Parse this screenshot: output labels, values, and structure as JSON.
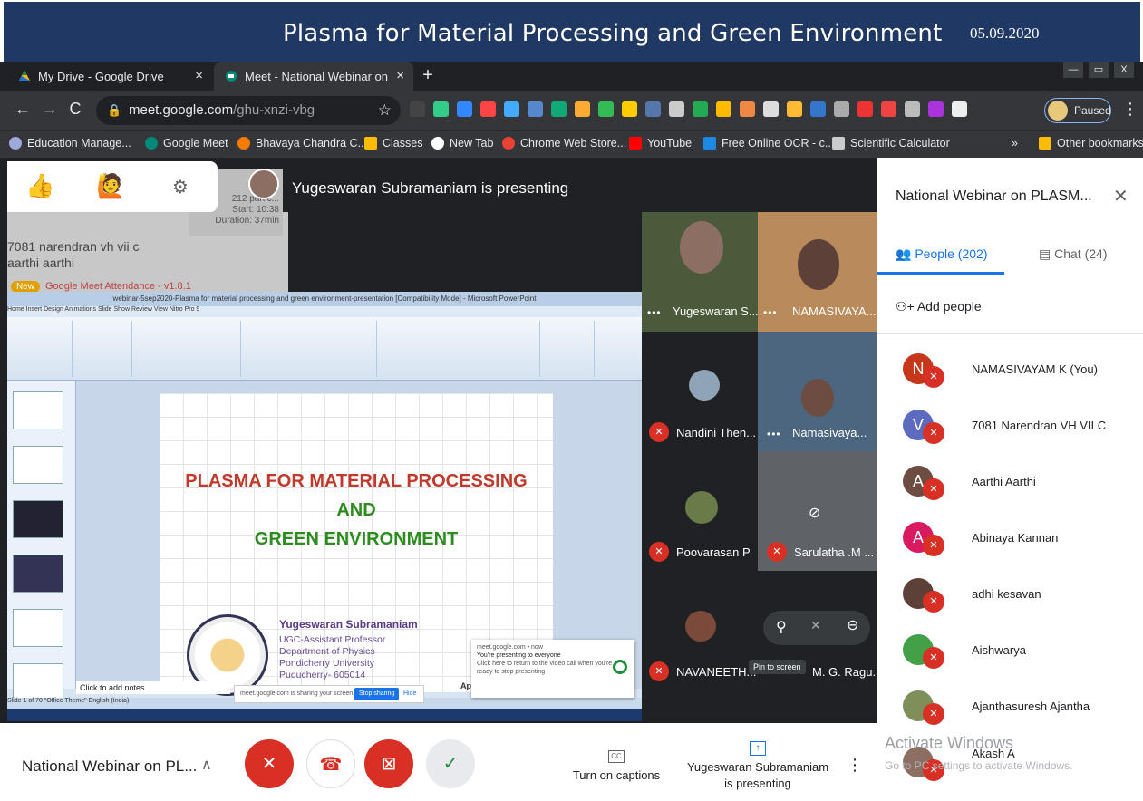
{
  "banner": {
    "title": "Plasma for Material Processing and Green Environment",
    "date": "05.09.2020"
  },
  "browser": {
    "tabs": [
      {
        "label": "My Drive - Google Drive"
      },
      {
        "label": "Meet - National Webinar on"
      }
    ],
    "window_controls": [
      "—",
      "▭",
      "X"
    ],
    "url_domain": "meet.google.com",
    "url_path": "/ghu-xnzi-vbg",
    "profile_label": "Paused",
    "bookmarks": [
      "Education Manage...",
      "Google Meet",
      "Bhavaya Chandra C...",
      "Classes",
      "New Tab",
      "Chrome Web Store...",
      "YouTube",
      "Free Online OCR - c...",
      "Scientific Calculator",
      "»",
      "Other bookmarks"
    ]
  },
  "meet": {
    "presenting_banner": "Yugeswaran Subramaniam is presenting",
    "background_attendance": {
      "lines": [
        "7081 narendran vh vii c",
        "aarthi aarthi"
      ],
      "new_badge": "New",
      "extension_label": "Google Meet Attendance - v1.8.1",
      "stats": [
        "212 partic...",
        "Start: 10:38",
        "Duration: 37min"
      ]
    },
    "slide": {
      "line1": "PLASMA FOR MATERIAL PROCESSING",
      "line2": "AND",
      "line3": "GREEN ENVIRONMENT",
      "author": "Yugeswaran Subramaniam",
      "affiliation": [
        "UGC-Assistant Professor",
        "Department of Physics",
        "Pondicherry University",
        "Puducherry- 605014"
      ]
    },
    "ppt": {
      "titlebar": "webinar-5sep2020-Plasma for material processing and green environment-presentation [Compatibility Mode] - Microsoft PowerPoint",
      "tabs": "Home   Insert   Design   Animations   Slide Show   Review   View   Nitro Pro 9",
      "notes_placeholder": "Click to add notes",
      "status": "Slide 1 of 70   \"Office Theme\"   English (India)",
      "share_bar_text": "meet.google.com is sharing your screen.",
      "stop_sharing": "Stop sharing",
      "hide": "Hide",
      "notif_source": "meet.google.com • now",
      "notif_title": "You're presenting to everyone",
      "notif_body": "Click here to return to the video call when you're ready to stop presenting",
      "app_label": "App"
    },
    "tiles": [
      {
        "name": "Yugeswaran S..."
      },
      {
        "name": "NAMASIVAYA..."
      },
      {
        "name": "Nandini Then..."
      },
      {
        "name": "Namasivaya..."
      },
      {
        "name": "Poovarasan P"
      },
      {
        "name": "Sarulatha .M ..."
      },
      {
        "name": "NAVANEETH..."
      },
      {
        "name": "M. G. Ragu..."
      }
    ],
    "pin_tooltip": "Pin to screen"
  },
  "side_panel": {
    "title": "National Webinar on PLASM...",
    "people_tab": "People (202)",
    "chat_tab": "Chat (24)",
    "add_people": "Add people",
    "participants": [
      {
        "initial": "N",
        "name": "NAMASIVAYAM K (You)",
        "color": "#c5361b"
      },
      {
        "initial": "V",
        "name": "7081 Narendran VH VII C",
        "color": "#5c6bc0"
      },
      {
        "initial": "A",
        "name": "Aarthi Aarthi",
        "color": "#6d4c41"
      },
      {
        "initial": "A",
        "name": "Abinaya Kannan",
        "color": "#d81b60"
      },
      {
        "initial": "",
        "name": "adhi kesavan",
        "color": "#5d4037"
      },
      {
        "initial": "",
        "name": "Aishwarya",
        "color": "#43a047"
      },
      {
        "initial": "",
        "name": "Ajanthasuresh Ajantha",
        "color": "#7e8f5a"
      },
      {
        "initial": "",
        "name": "Akash A",
        "color": "#8d6e63"
      }
    ],
    "activate_title": "Activate Windows",
    "activate_sub": "Go to PC settings to activate Windows."
  },
  "bottom_bar": {
    "meeting_name": "National Webinar on PL...",
    "captions_label": "Turn on captions",
    "captions_icon": "CC",
    "presenting_status": [
      "Yugeswaran Subramaniam",
      "is presenting"
    ]
  },
  "colors": {
    "banner_bg": "#1f3864",
    "mute_red": "#d93025",
    "accent_blue": "#1a73e8",
    "check_green": "#1e8e3e"
  }
}
